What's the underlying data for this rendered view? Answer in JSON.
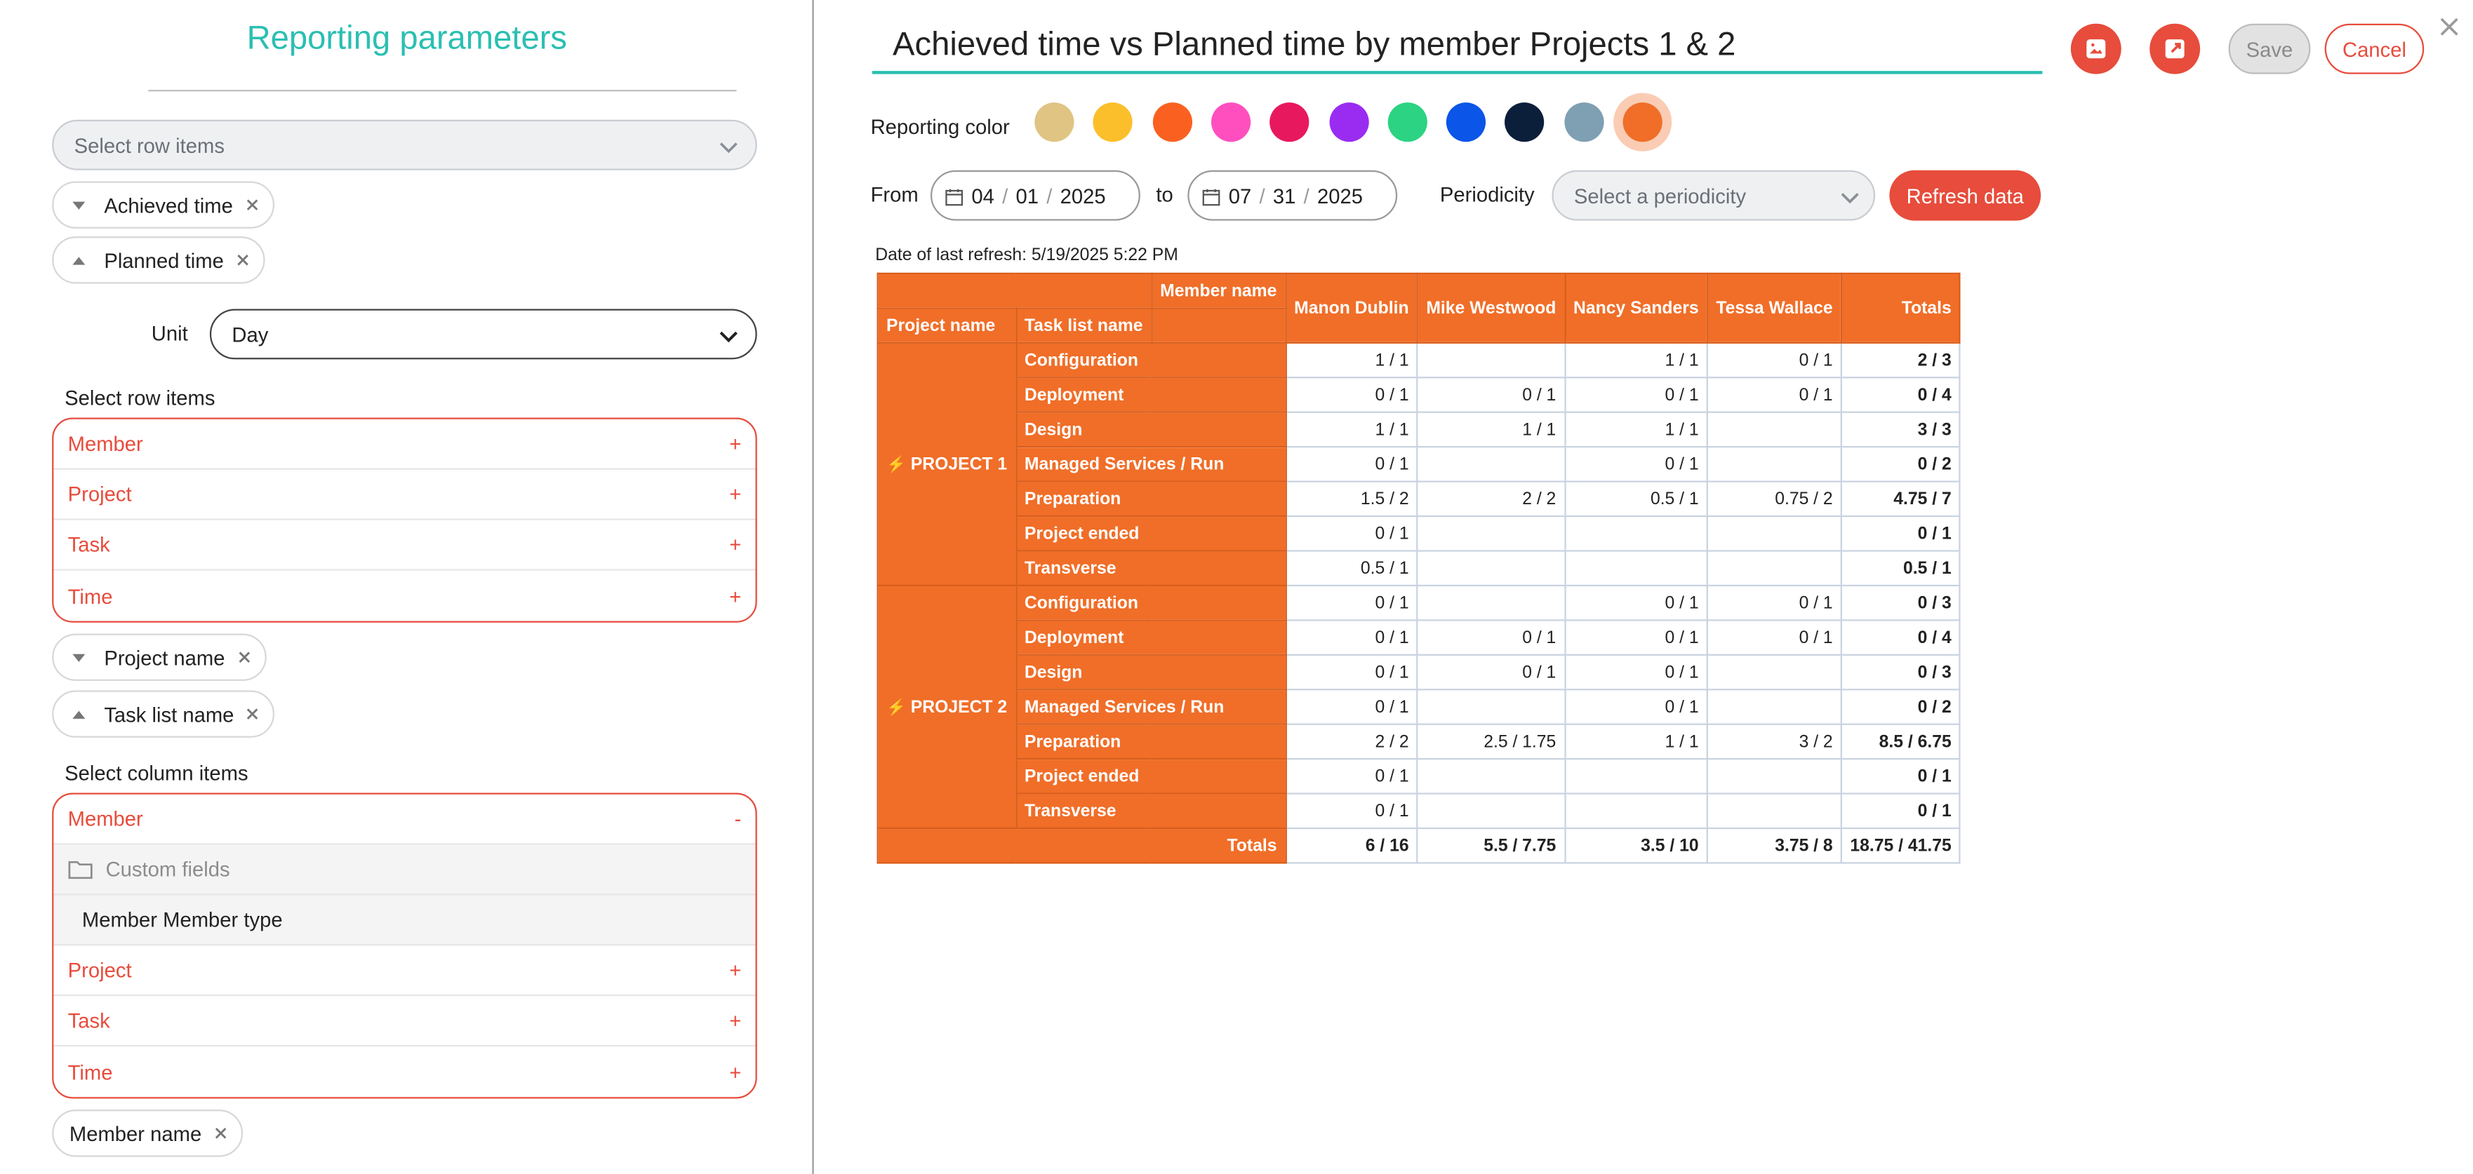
{
  "left": {
    "title": "Reporting parameters",
    "top_select_placeholder": "Select row items",
    "sort_chips_top": [
      {
        "label": "Achieved time",
        "dir": "down"
      },
      {
        "label": "Planned time",
        "dir": "up"
      }
    ],
    "unit": {
      "label": "Unit",
      "value": "Day"
    },
    "row_items": {
      "label": "Select row items",
      "items": [
        "Member",
        "Project",
        "Task",
        "Time"
      ],
      "toggle": "+"
    },
    "row_chips": [
      {
        "label": "Project name",
        "dir": "down"
      },
      {
        "label": "Task list name",
        "dir": "up"
      }
    ],
    "column_items": {
      "label": "Select column items",
      "member": {
        "label": "Member",
        "toggle": "-"
      },
      "custom_fields": "Custom fields",
      "member_type": "Member Member type",
      "items": [
        "Project",
        "Task",
        "Time"
      ],
      "toggle": "+"
    },
    "column_chips": [
      {
        "label": "Member name"
      }
    ]
  },
  "right": {
    "title": "Achieved time vs Planned time by member Projects 1 & 2",
    "save_label": "Save",
    "cancel_label": "Cancel",
    "reporting_color_label": "Reporting color",
    "colors": [
      "#e0c483",
      "#fbbf2b",
      "#fa6121",
      "#ff4fbf",
      "#e8185f",
      "#9a2cf2",
      "#2bd382",
      "#0b55e8",
      "#0b1f3b",
      "#7f9fb2",
      "#f06e28"
    ],
    "selected_color_index": 10,
    "from_label": "From",
    "to_label": "to",
    "from_date": {
      "m": "04",
      "d": "01",
      "y": "2025"
    },
    "to_date": {
      "m": "07",
      "d": "31",
      "y": "2025"
    },
    "periodicity_label": "Periodicity",
    "periodicity_placeholder": "Select a periodicity",
    "refresh_label": "Refresh data",
    "last_refresh": "Date of last refresh: 5/19/2025 5:22 PM"
  },
  "table": {
    "member_name_header": "Member name",
    "project_name_header": "Project name",
    "task_list_header": "Task list name",
    "members": [
      "Manon Dublin",
      "Mike Westwood",
      "Nancy Sanders",
      "Tessa Wallace"
    ],
    "totals_header": "Totals",
    "projects": [
      {
        "name": "PROJECT 1",
        "rows": [
          {
            "task": "Configuration",
            "values": [
              "1 / 1",
              "",
              "1 / 1",
              "0 / 1"
            ],
            "total": "2 / 3"
          },
          {
            "task": "Deployment",
            "values": [
              "0 / 1",
              "0 / 1",
              "0 / 1",
              "0 / 1"
            ],
            "total": "0 / 4"
          },
          {
            "task": "Design",
            "values": [
              "1 / 1",
              "1 / 1",
              "1 / 1",
              ""
            ],
            "total": "3 / 3"
          },
          {
            "task": "Managed Services / Run",
            "values": [
              "0 / 1",
              "",
              "0 / 1",
              ""
            ],
            "total": "0 / 2"
          },
          {
            "task": "Preparation",
            "values": [
              "1.5 / 2",
              "2 / 2",
              "0.5 / 1",
              "0.75 / 2"
            ],
            "total": "4.75 / 7"
          },
          {
            "task": "Project ended",
            "values": [
              "0 / 1",
              "",
              "",
              ""
            ],
            "total": "0 / 1"
          },
          {
            "task": "Transverse",
            "values": [
              "0.5 / 1",
              "",
              "",
              ""
            ],
            "total": "0.5 / 1"
          }
        ]
      },
      {
        "name": "PROJECT 2",
        "rows": [
          {
            "task": "Configuration",
            "values": [
              "0 / 1",
              "",
              "0 / 1",
              "0 / 1"
            ],
            "total": "0 / 3"
          },
          {
            "task": "Deployment",
            "values": [
              "0 / 1",
              "0 / 1",
              "0 / 1",
              "0 / 1"
            ],
            "total": "0 / 4"
          },
          {
            "task": "Design",
            "values": [
              "0 / 1",
              "0 / 1",
              "0 / 1",
              ""
            ],
            "total": "0 / 3"
          },
          {
            "task": "Managed Services / Run",
            "values": [
              "0 / 1",
              "",
              "0 / 1",
              ""
            ],
            "total": "0 / 2"
          },
          {
            "task": "Preparation",
            "values": [
              "2 / 2",
              "2.5 / 1.75",
              "1 / 1",
              "3 / 2"
            ],
            "total": "8.5 / 6.75"
          },
          {
            "task": "Project ended",
            "values": [
              "0 / 1",
              "",
              "",
              ""
            ],
            "total": "0 / 1"
          },
          {
            "task": "Transverse",
            "values": [
              "0 / 1",
              "",
              "",
              ""
            ],
            "total": "0 / 1"
          }
        ]
      }
    ],
    "totals_row": {
      "label": "Totals",
      "values": [
        "6 / 16",
        "5.5 / 7.75",
        "3.5 / 10",
        "3.75 / 8"
      ],
      "total": "18.75 / 41.75"
    }
  },
  "icons": {
    "sort_down": "sort-down-icon",
    "sort_up": "sort-up-icon",
    "remove": "close-icon",
    "chevron": "chevron-down-icon",
    "calendar": "calendar-icon",
    "image_export": "image-export-icon",
    "share_export": "export-icon",
    "folder": "folder-icon",
    "bolt": "bolt-icon"
  }
}
